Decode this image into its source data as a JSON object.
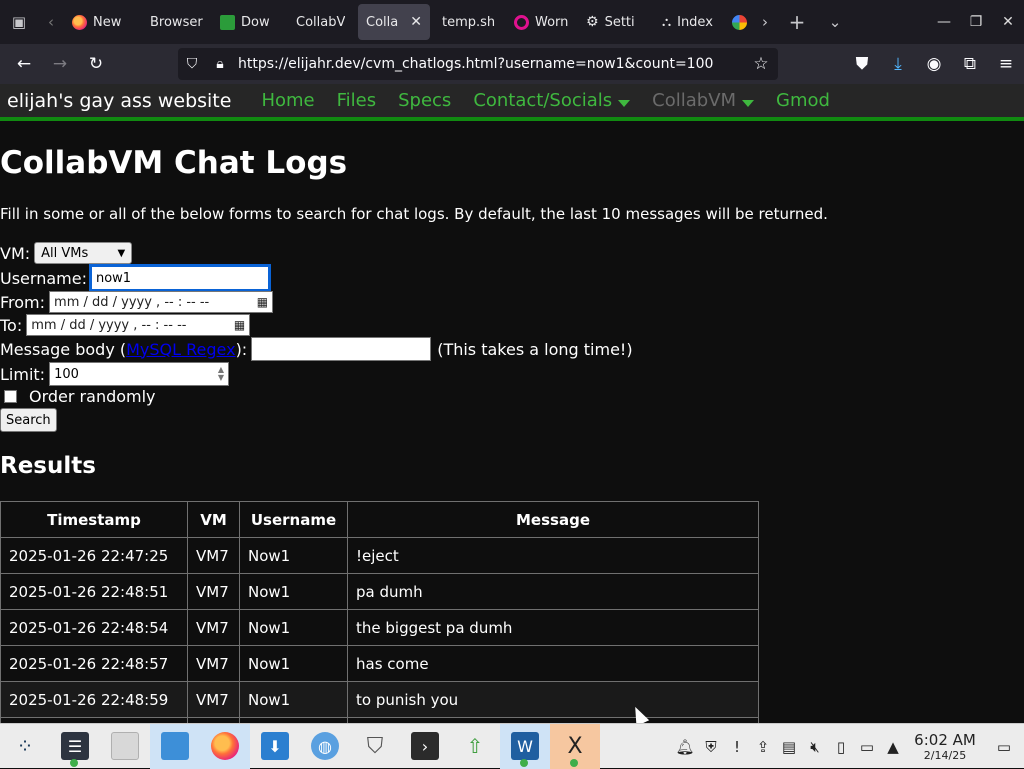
{
  "browser": {
    "tabs": [
      {
        "label": "New",
        "icon": "firefox-icon"
      },
      {
        "label": "Browser",
        "icon": "none"
      },
      {
        "label": "Dow",
        "icon": "download-site-icon"
      },
      {
        "label": "CollabV",
        "icon": "none"
      },
      {
        "label": "Collab",
        "icon": "none",
        "active": true
      },
      {
        "label": "temp.sh",
        "icon": "none"
      },
      {
        "label": "Worn",
        "icon": "ring-icon"
      },
      {
        "label": "Setti",
        "icon": "gear-icon"
      },
      {
        "label": "Index",
        "icon": "network-icon"
      },
      {
        "label": "",
        "icon": "google-icon"
      }
    ],
    "url": "https://elijahr.dev/cvm_chatlogs.html?username=now1&count=100"
  },
  "site": {
    "brand": "elijah's gay ass website",
    "nav": [
      {
        "label": "Home"
      },
      {
        "label": "Files"
      },
      {
        "label": "Specs"
      },
      {
        "label": "Contact/Socials",
        "dropdown": true
      },
      {
        "label": "CollabVM",
        "dropdown": true,
        "current": true
      },
      {
        "label": "Gmod"
      }
    ],
    "accent": "#3fb83f"
  },
  "page": {
    "title": "CollabVM Chat Logs",
    "intro": "Fill in some or all of the below forms to search for chat logs. By default, the last 10 messages will be returned.",
    "form": {
      "vm_label": "VM:",
      "vm_value": "All VMs",
      "username_label": "Username:",
      "username_value": "now1",
      "from_label": "From:",
      "to_label": "To:",
      "date_placeholder": "mm / dd / yyyy ,  -- : --  --",
      "body_label_pre": "Message body (",
      "body_link": "MySQL Regex",
      "body_label_post": "):",
      "body_note": "(This takes a long time!)",
      "limit_label": "Limit:",
      "limit_value": "100",
      "random_label": "Order randomly",
      "search_button": "Search"
    },
    "results_title": "Results",
    "table": {
      "headers": [
        "Timestamp",
        "VM",
        "Username",
        "Message"
      ],
      "rows": [
        [
          "2025-01-26 22:47:25",
          "VM7",
          "Now1",
          "!eject"
        ],
        [
          "2025-01-26 22:48:51",
          "VM7",
          "Now1",
          "pa dumh"
        ],
        [
          "2025-01-26 22:48:54",
          "VM7",
          "Now1",
          "the biggest pa dumh"
        ],
        [
          "2025-01-26 22:48:57",
          "VM7",
          "Now1",
          "has come"
        ],
        [
          "2025-01-26 22:48:59",
          "VM7",
          "Now1",
          "to punish you"
        ]
      ]
    }
  },
  "taskbar": {
    "time": "6:02 AM",
    "date": "2/14/25"
  }
}
